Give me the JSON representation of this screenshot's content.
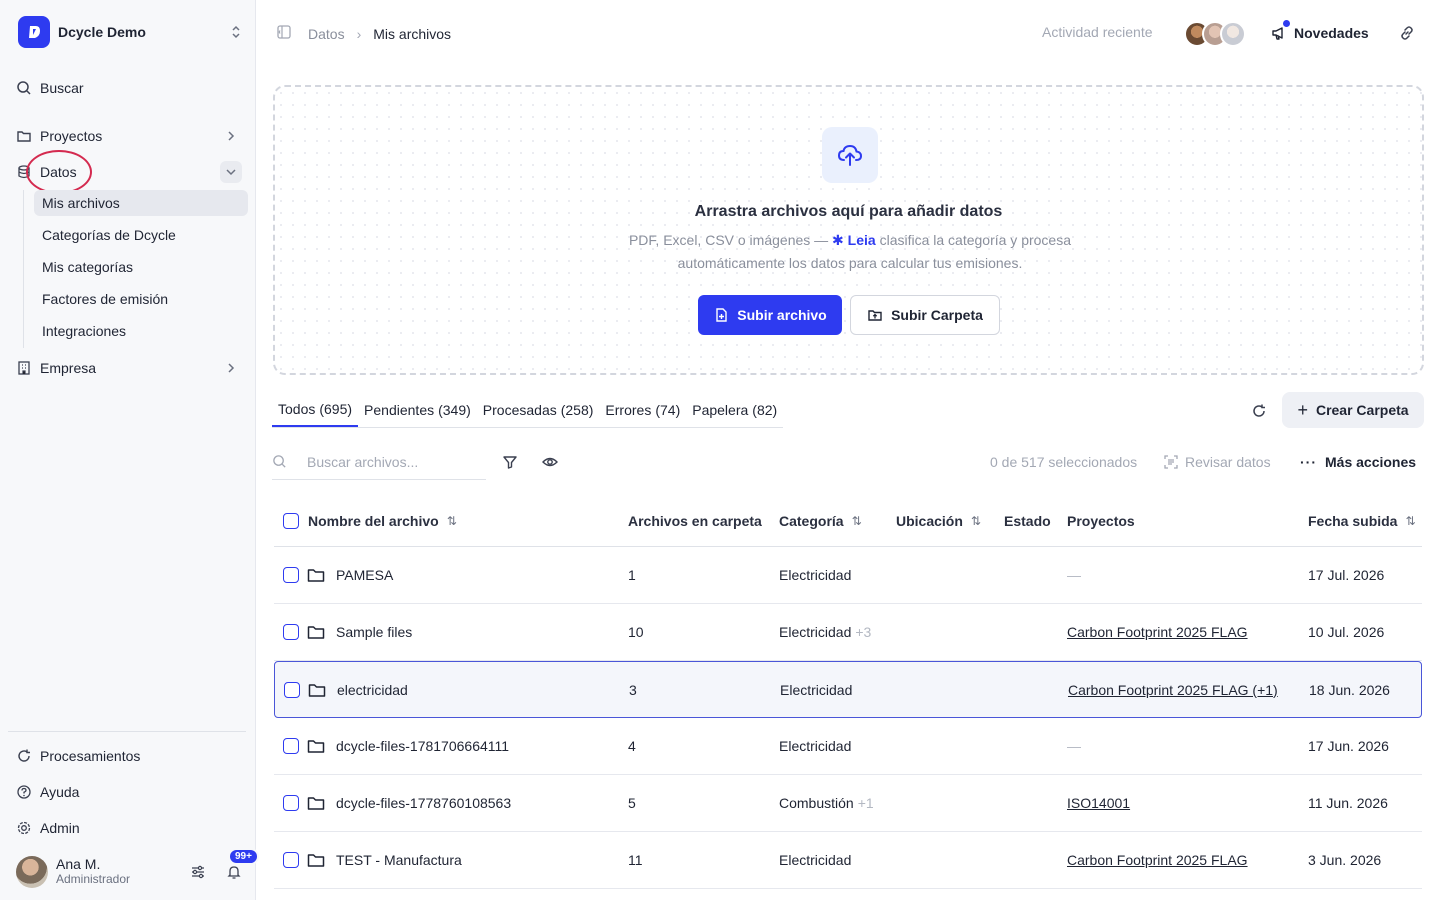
{
  "workspace": {
    "name": "Dcycle Demo"
  },
  "sidebar": {
    "search_label": "Buscar",
    "items": [
      {
        "label": "Proyectos"
      },
      {
        "label": "Datos"
      },
      {
        "label": "Empresa"
      }
    ],
    "datos_sub": [
      {
        "label": "Mis archivos"
      },
      {
        "label": "Categorías de Dcycle"
      },
      {
        "label": "Mis categorías"
      },
      {
        "label": "Factores de emisión"
      },
      {
        "label": "Integraciones"
      }
    ],
    "bottom": [
      {
        "label": "Procesamientos"
      },
      {
        "label": "Ayuda"
      },
      {
        "label": "Admin"
      }
    ],
    "user": {
      "name": "Ana M.",
      "role": "Administrador",
      "notifications": "99+"
    }
  },
  "topbar": {
    "breadcrumb": [
      "Datos",
      "Mis archivos"
    ],
    "activity_label": "Actividad reciente",
    "news_label": "Novedades"
  },
  "upload": {
    "title": "Arrastra archivos aquí para añadir datos",
    "desc_pre": "PDF, Excel, CSV o imágenes — ",
    "leia": "Leia",
    "desc_post": " clasifica la categoría y procesa automáticamente los datos para calcular tus emisiones.",
    "upload_file": "Subir archivo",
    "upload_folder": "Subir Carpeta"
  },
  "tabs": [
    {
      "label": "Todos",
      "count": "(695)"
    },
    {
      "label": "Pendientes",
      "count": "(349)"
    },
    {
      "label": "Procesadas",
      "count": "(258)"
    },
    {
      "label": "Errores",
      "count": "(74)"
    },
    {
      "label": "Papelera",
      "count": "(82)"
    }
  ],
  "actions": {
    "create_folder": "Crear Carpeta",
    "search_placeholder": "Buscar archivos...",
    "selection": "0 de 517 seleccionados",
    "review": "Revisar datos",
    "more": "Más acciones"
  },
  "table": {
    "columns": [
      "Nombre del archivo",
      "Archivos en carpeta",
      "Categoría",
      "Ubicación",
      "Estado",
      "Proyectos",
      "Fecha subida"
    ],
    "rows": [
      {
        "name": "PAMESA",
        "count": "1",
        "category": "Electricidad",
        "extra": "",
        "location": "",
        "status": "",
        "project": "",
        "project_empty": "—",
        "date": "17 Jul. 2026"
      },
      {
        "name": "Sample files",
        "count": "10",
        "category": "Electricidad",
        "extra": "+3",
        "location": "",
        "status": "",
        "project": "Carbon Footprint 2025 FLAG",
        "project_empty": "",
        "date": "10 Jul. 2026"
      },
      {
        "name": "electricidad",
        "count": "3",
        "category": "Electricidad",
        "extra": "",
        "location": "",
        "status": "",
        "project": "Carbon Footprint 2025 FLAG (+1)",
        "project_empty": "",
        "date": "18 Jun. 2026"
      },
      {
        "name": "dcycle-files-1781706664111",
        "count": "4",
        "category": "Electricidad",
        "extra": "",
        "location": "",
        "status": "",
        "project": "",
        "project_empty": "—",
        "date": "17 Jun. 2026"
      },
      {
        "name": "dcycle-files-1778760108563",
        "count": "5",
        "category": "Combustión",
        "extra": "+1",
        "location": "",
        "status": "",
        "project": "ISO14001",
        "project_empty": "",
        "date": "11 Jun. 2026"
      },
      {
        "name": "TEST - Manufactura",
        "count": "11",
        "category": "Electricidad",
        "extra": "",
        "location": "",
        "status": "",
        "project": "Carbon Footprint 2025 FLAG",
        "project_empty": "",
        "date": "3 Jun. 2026"
      }
    ]
  },
  "colors": {
    "accent": "#2e3bf0",
    "highlight_circle": "#d42a4f"
  }
}
